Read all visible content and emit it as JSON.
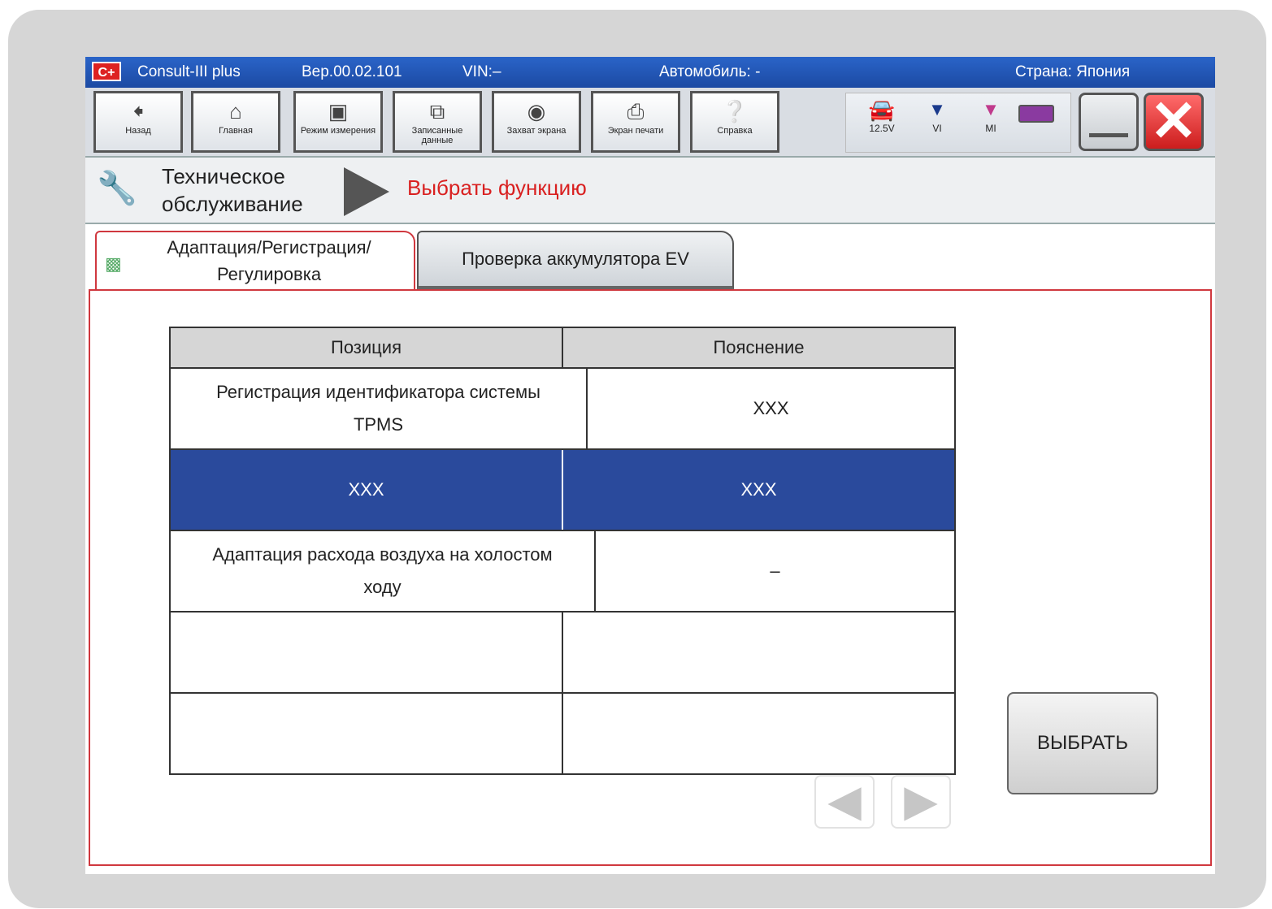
{
  "titlebar": {
    "app_name": "Consult-III plus",
    "version": "Вер.00.02.101",
    "vin": "VIN:–",
    "vehicle": "Автомобиль: -",
    "country": "Страна: Япония"
  },
  "toolbar": {
    "back": {
      "label": "Назад",
      "icon": "back-arrow-icon"
    },
    "home": {
      "label": "Главная",
      "icon": "home-icon"
    },
    "measurement_mode": {
      "label": "Режим измерения",
      "icon": "measurement-mode-icon"
    },
    "recorded_data": {
      "label": "Записанные данные",
      "icon": "recorded-data-icon"
    },
    "screen_capture": {
      "label": "Захват экрана",
      "icon": "camera-icon"
    },
    "print_screen": {
      "label": "Экран печати",
      "icon": "printer-icon"
    },
    "help": {
      "label": "Справка",
      "icon": "help-icon"
    }
  },
  "status": {
    "voltage": "12.5V",
    "vi": "VI",
    "mi": "MI"
  },
  "breadcrumb": {
    "parent": "Техническое обслуживание",
    "current": "Выбрать функцию"
  },
  "tabs": [
    {
      "label": "Адаптация/Регистрация/ Регулировка",
      "active": true
    },
    {
      "label": "Проверка аккумулятора EV",
      "active": false
    }
  ],
  "table": {
    "headers": [
      "Позиция",
      "Пояснение"
    ],
    "rows": [
      {
        "item": "Регистрация идентификатора системы TPMS",
        "desc": "XXX",
        "selected": false
      },
      {
        "item": "XXX",
        "desc": "XXX",
        "selected": true
      },
      {
        "item": "Адаптация расхода воздуха на холостом ходу",
        "desc": "–",
        "selected": false
      },
      {
        "item": "",
        "desc": "",
        "selected": false
      },
      {
        "item": "",
        "desc": "",
        "selected": false
      }
    ]
  },
  "select_button": "ВЫБРАТЬ",
  "colors": {
    "titlebar": "#1c4aa3",
    "selected_row": "#2a4a9c",
    "breadcrumb_current": "#d92020",
    "tab_border": "#d0383f",
    "close_button": "#cc1d1d"
  }
}
